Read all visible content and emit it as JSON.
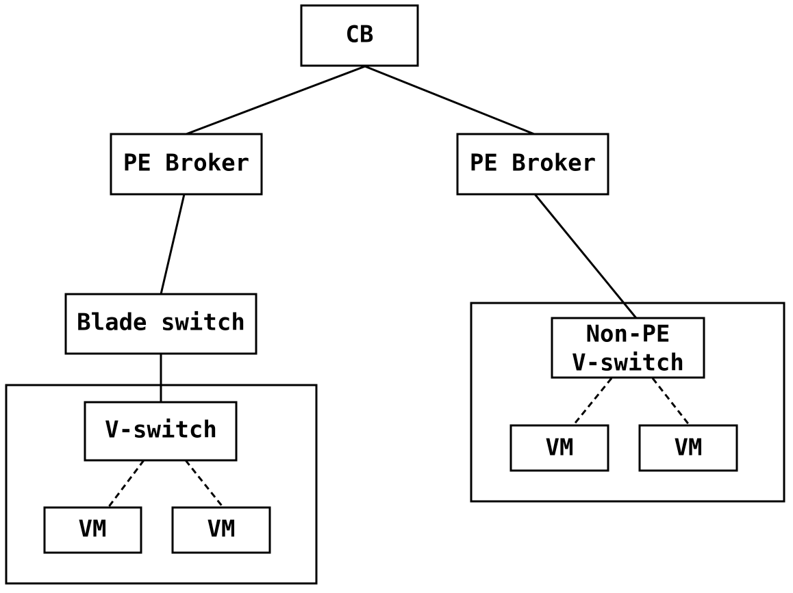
{
  "diagram": {
    "type": "network topology",
    "nodes": [
      {
        "id": "cb",
        "label": "CB"
      },
      {
        "id": "pe_broker_left",
        "label": "PE Broker"
      },
      {
        "id": "pe_broker_right",
        "label": "PE Broker"
      },
      {
        "id": "blade_switch",
        "label": "Blade switch"
      },
      {
        "id": "v_switch",
        "label": "V-switch"
      },
      {
        "id": "vm_left_1",
        "label": "VM"
      },
      {
        "id": "vm_left_2",
        "label": "VM"
      },
      {
        "id": "non_pe_v_switch",
        "label_lines": [
          "Non-PE",
          "V-switch"
        ]
      },
      {
        "id": "vm_right_1",
        "label": "VM"
      },
      {
        "id": "vm_right_2",
        "label": "VM"
      }
    ],
    "edges": [
      {
        "from": "cb",
        "to": "pe_broker_left",
        "style": "solid"
      },
      {
        "from": "cb",
        "to": "pe_broker_right",
        "style": "solid"
      },
      {
        "from": "pe_broker_left",
        "to": "blade_switch",
        "style": "solid"
      },
      {
        "from": "blade_switch",
        "to": "v_switch",
        "style": "solid"
      },
      {
        "from": "v_switch",
        "to": "vm_left_1",
        "style": "dashed"
      },
      {
        "from": "v_switch",
        "to": "vm_left_2",
        "style": "dashed"
      },
      {
        "from": "pe_broker_right",
        "to": "non_pe_v_switch",
        "style": "solid"
      },
      {
        "from": "non_pe_v_switch",
        "to": "vm_right_1",
        "style": "dashed"
      },
      {
        "from": "non_pe_v_switch",
        "to": "vm_right_2",
        "style": "dashed"
      }
    ],
    "groups": [
      {
        "id": "left_server",
        "contains": [
          "v_switch",
          "vm_left_1",
          "vm_left_2"
        ]
      },
      {
        "id": "right_server",
        "contains": [
          "non_pe_v_switch",
          "vm_right_1",
          "vm_right_2"
        ]
      }
    ]
  },
  "labels": {
    "cb": "CB",
    "pe_broker_left": "PE Broker",
    "pe_broker_right": "PE Broker",
    "blade_switch": "Blade switch",
    "v_switch": "V-switch",
    "vm_left_1": "VM",
    "vm_left_2": "VM",
    "non_pe_line1": "Non-PE",
    "non_pe_line2": "V-switch",
    "vm_right_1": "VM",
    "vm_right_2": "VM"
  }
}
